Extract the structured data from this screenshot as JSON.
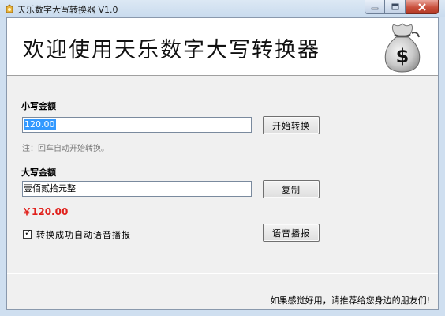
{
  "window": {
    "title": "天乐数字大写转换器 V1.0",
    "app_icon": "app-icon",
    "caption_buttons": [
      "minimize-icon",
      "maximize-icon",
      "close-icon"
    ]
  },
  "banner": {
    "title": "欢迎使用天乐数字大写转换器",
    "icon": "money-bag-icon",
    "icon_symbol": "$"
  },
  "small": {
    "label": "小写金额",
    "value": "120.00",
    "convert_button": "开始转换",
    "note": "注：回车自动开始转换。"
  },
  "big": {
    "label": "大写金额",
    "value": "壹佰贰拾元整",
    "copy_button": "复制",
    "currency_value": "￥120.00"
  },
  "speech": {
    "checked": true,
    "label": "转换成功自动语音播报",
    "button": "语音播报"
  },
  "footer": {
    "text": "如果感觉好用，请推荐给您身边的朋友们!"
  },
  "colors": {
    "accent_red": "#e0201b",
    "selection": "#3399ff",
    "titlebar": "#cfdff0"
  }
}
